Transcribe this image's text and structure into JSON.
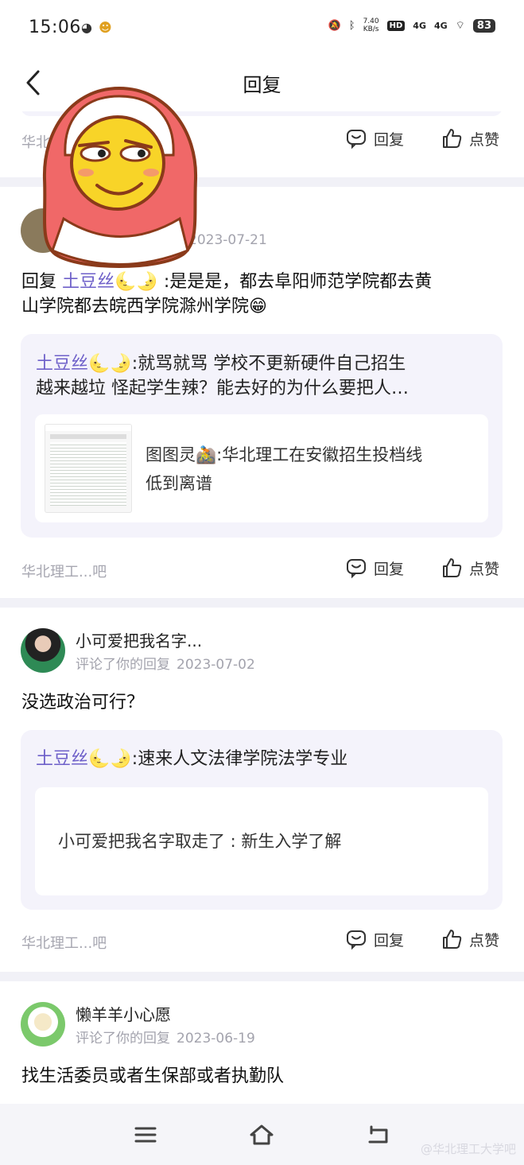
{
  "status_bar": {
    "time": "15:06",
    "net_speed_value": "7.40",
    "net_speed_unit": "KB/s",
    "hd": "HD",
    "signal1": "4G",
    "signal2": "4G",
    "battery": "83"
  },
  "header": {
    "title": "回复"
  },
  "cards": [
    {
      "forum": "华北",
      "reply_label": "回复",
      "like_label": "点赞"
    },
    {
      "date": "2023-07-21",
      "reply_prefix": "回复",
      "mention": "土豆丝🌜🌛",
      "text_line1": ":是是是，都去阜阳师范学院都去黄",
      "text_line2": "山学院都去皖西学院滁州学院😁",
      "quote_author": "土豆丝🌜🌛",
      "quote_text_line1": ":就骂就骂 学校不更新硬件自己招生",
      "quote_text_line2": "越来越垃 怪起学生辣？能去好的为什么要把人…",
      "inner_author": "图图灵🚵",
      "inner_text_line1": ":华北理工在安徽招生投档线",
      "inner_text_line2": "低到离谱",
      "forum": "华北理工...吧",
      "reply_label": "回复",
      "like_label": "点赞"
    },
    {
      "user_name": "小可爱把我名字...",
      "meta_action": "评论了你的回复",
      "date": "2023-07-02",
      "text": "没选政治可行？",
      "quote_author": "土豆丝🌜🌛",
      "quote_text": ":速来人文法律学院法学专业",
      "inner_text": "小可爱把我名字取走了 : 新生入学了解",
      "forum": "华北理工...吧",
      "reply_label": "回复",
      "like_label": "点赞"
    },
    {
      "user_name": "懒羊羊小心愿",
      "meta_action": "评论了你的回复",
      "date": "2023-06-19",
      "text": "找生活委员或者生保部或者执勤队"
    }
  ],
  "nav_bar": {
    "menu": "menu-icon",
    "home": "home-icon",
    "back": "back-icon",
    "watermark": "@华北理工大学吧"
  },
  "colors": {
    "accent": "#6e60c9",
    "quote_bg": "#f4f3fb",
    "page_bg": "#f1f1f7",
    "muted": "#a7a7b1"
  }
}
